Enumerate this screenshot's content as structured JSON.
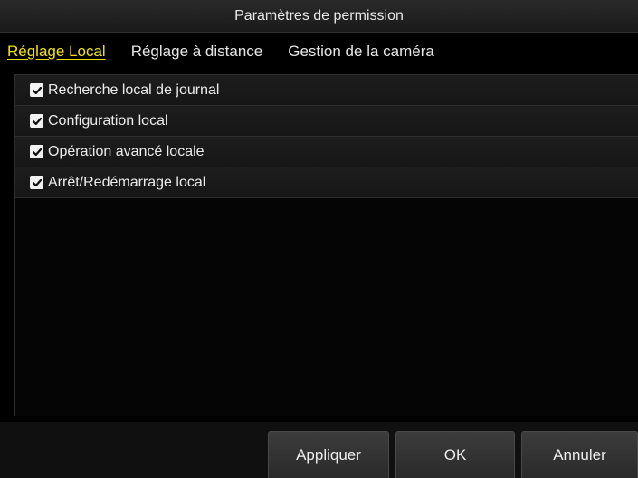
{
  "dialog": {
    "title": "Paramètres de permission"
  },
  "tabs": [
    {
      "label": "Réglage Local",
      "active": true
    },
    {
      "label": "Réglage à distance",
      "active": false
    },
    {
      "label": "Gestion de la caméra",
      "active": false
    }
  ],
  "permissions": [
    {
      "label": "Recherche local de journal",
      "checked": true
    },
    {
      "label": "Configuration local",
      "checked": true
    },
    {
      "label": "Opération avancé locale",
      "checked": true
    },
    {
      "label": "Arrêt/Redémarrage local",
      "checked": true
    }
  ],
  "buttons": {
    "apply": "Appliquer",
    "ok": "OK",
    "cancel": "Annuler"
  },
  "colors": {
    "active_tab": "#f0e200",
    "background": "#000000"
  }
}
